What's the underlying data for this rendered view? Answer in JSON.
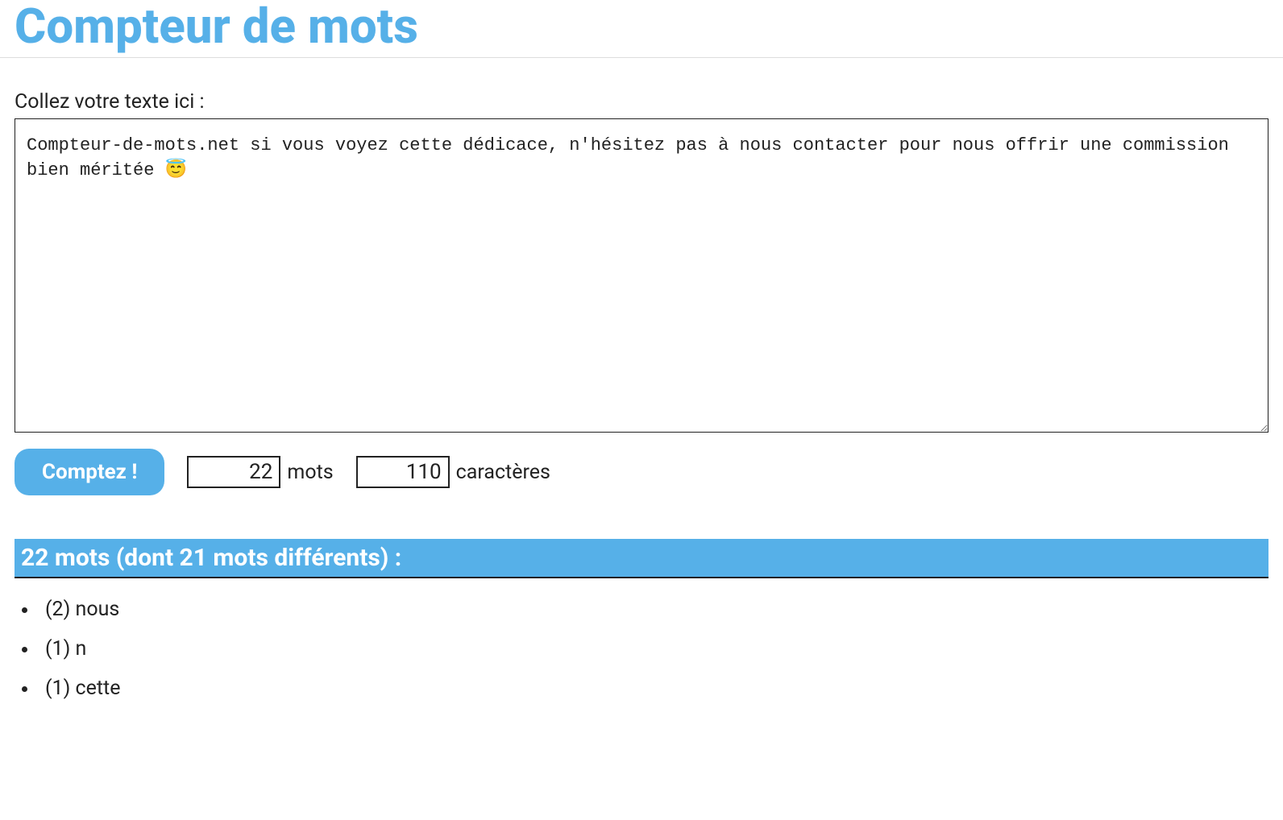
{
  "page": {
    "title": "Compteur de mots"
  },
  "input": {
    "label": "Collez votre texte ici :",
    "value": "Compteur-de-mots.net si vous voyez cette dédicace, n'hésitez pas à nous contacter pour nous offrir une commission bien méritée 😇"
  },
  "actions": {
    "count_label": "Comptez !"
  },
  "results": {
    "word_count": "22",
    "word_label": "mots",
    "char_count": "110",
    "char_label": "caractères"
  },
  "summary": {
    "heading": "22 mots (dont 21 mots différents) :"
  },
  "word_list": [
    {
      "display": "(2) nous"
    },
    {
      "display": "(1) n"
    },
    {
      "display": "(1) cette"
    }
  ]
}
